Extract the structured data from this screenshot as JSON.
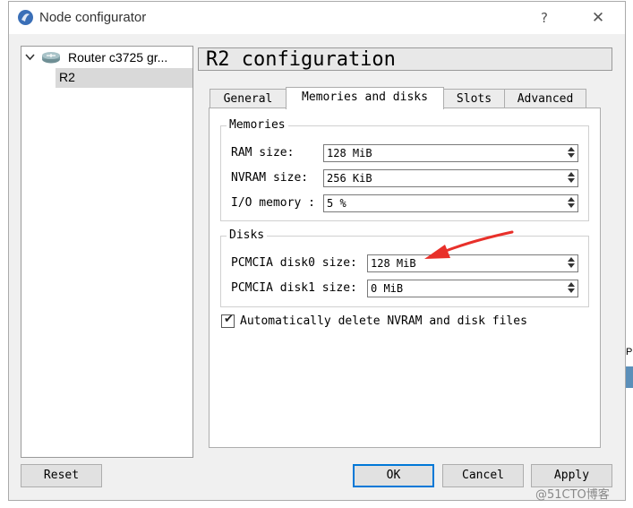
{
  "window": {
    "title": "Node configurator",
    "help_glyph": "?",
    "close_glyph": "✕"
  },
  "tree": {
    "group_label": "Router c3725 gr...",
    "child_label": "R2"
  },
  "header": {
    "title": "R2 configuration"
  },
  "tabs": [
    {
      "label": "General",
      "active": false
    },
    {
      "label": "Memories and disks",
      "active": true
    },
    {
      "label": "Slots",
      "active": false
    },
    {
      "label": "Advanced",
      "active": false
    }
  ],
  "memories": {
    "title": "Memories",
    "ram_label": "RAM size:",
    "ram_value": "128 MiB",
    "nvram_label": "NVRAM size:",
    "nvram_value": "256 KiB",
    "io_label": "I/O memory :",
    "io_value": "5 %"
  },
  "disks": {
    "title": "Disks",
    "disk0_label": "PCMCIA disk0 size:",
    "disk0_value": "128 MiB",
    "disk1_label": "PCMCIA disk1 size:",
    "disk1_value": "0 MiB"
  },
  "auto_delete": {
    "label": "Automatically delete NVRAM and disk files",
    "checked": true
  },
  "buttons": {
    "reset": "Reset",
    "ok": "OK",
    "cancel": "Cancel",
    "apply": "Apply"
  },
  "background": {
    "fragment_text": "PC",
    "watermark": "@51CTO博客"
  },
  "colors": {
    "annotation_arrow": "#e8302a",
    "focus_border": "#0078d7"
  },
  "icons": {
    "app": "gns3-app-icon",
    "router": "router-icon",
    "expand": "chevron-down-icon"
  }
}
